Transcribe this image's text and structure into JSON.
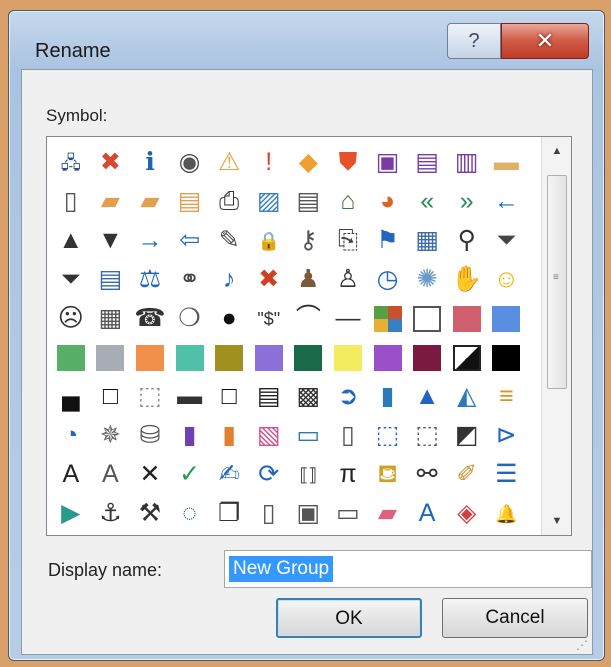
{
  "dialog": {
    "title": "Rename",
    "help_label": "?",
    "close_label": "✕"
  },
  "symbol_label": "Symbol:",
  "symbols": [
    {
      "name": "org-chart-icon",
      "glyph": "🖧",
      "color": "#2a4a8a"
    },
    {
      "name": "error-icon",
      "glyph": "✖",
      "color": "#d8472e"
    },
    {
      "name": "info-icon",
      "glyph": "ℹ",
      "color": "#2062b8"
    },
    {
      "name": "target-icon",
      "glyph": "◉",
      "color": "#555555"
    },
    {
      "name": "warning-icon",
      "glyph": "⚠",
      "color": "#e6a23c"
    },
    {
      "name": "exclamation-icon",
      "glyph": "!",
      "color": "#e04030"
    },
    {
      "name": "diamond-warning-icon",
      "glyph": "◆",
      "color": "#f0a030"
    },
    {
      "name": "shield-icon",
      "glyph": "⛊",
      "color": "#e8502a"
    },
    {
      "name": "save-icon",
      "glyph": "▣",
      "color": "#7a3aa8"
    },
    {
      "name": "translate-icon",
      "glyph": "▤",
      "color": "#7a3aa8"
    },
    {
      "name": "compare-icon",
      "glyph": "▥",
      "color": "#7a3aa8"
    },
    {
      "name": "folder-icon",
      "glyph": "▬",
      "color": "#e0b068"
    },
    {
      "name": "new-page-icon",
      "glyph": "▯",
      "color": "#555555"
    },
    {
      "name": "folder-up-icon",
      "glyph": "▰",
      "color": "#e0a050"
    },
    {
      "name": "folders-icon",
      "glyph": "▰",
      "color": "#e0a050"
    },
    {
      "name": "folder-list-icon",
      "glyph": "▤",
      "color": "#e0a050"
    },
    {
      "name": "print-icon",
      "glyph": "⎙",
      "color": "#333333"
    },
    {
      "name": "picture-icon",
      "glyph": "▨",
      "color": "#3a80c0"
    },
    {
      "name": "document-edit-icon",
      "glyph": "▤",
      "color": "#555555"
    },
    {
      "name": "home-icon",
      "glyph": "⌂",
      "color": "#3a7a3a"
    },
    {
      "name": "pie-chart-icon",
      "glyph": "◕",
      "color": "#e06020"
    },
    {
      "name": "back-double-icon",
      "glyph": "«",
      "color": "#2a8a5a"
    },
    {
      "name": "forward-double-icon",
      "glyph": "»",
      "color": "#2a8a5a"
    },
    {
      "name": "left-arrow-icon",
      "glyph": "←",
      "color": "#2066c0"
    },
    {
      "name": "triangle-up-icon",
      "glyph": "▲",
      "color": "#333333"
    },
    {
      "name": "triangle-down-icon",
      "glyph": "▼",
      "color": "#333333"
    },
    {
      "name": "right-arrow-icon",
      "glyph": "→",
      "color": "#2066c0"
    },
    {
      "name": "circle-left-arrow-icon",
      "glyph": "⇦",
      "color": "#2066c0"
    },
    {
      "name": "pin-icon",
      "glyph": "✎",
      "color": "#444444"
    },
    {
      "name": "lock-icon",
      "glyph": "🔒",
      "color": "#d89030"
    },
    {
      "name": "key-icon",
      "glyph": "⚷",
      "color": "#555555"
    },
    {
      "name": "script-icon",
      "glyph": "⎘",
      "color": "#444444"
    },
    {
      "name": "flag-icon",
      "glyph": "⚑",
      "color": "#2066c0"
    },
    {
      "name": "calendar-icon",
      "glyph": "▦",
      "color": "#3a6aa8"
    },
    {
      "name": "magnifier-icon",
      "glyph": "⚲",
      "color": "#333333"
    },
    {
      "name": "filter-icon",
      "glyph": "⏷",
      "color": "#444444"
    },
    {
      "name": "funnel-icon",
      "glyph": "⏷",
      "color": "#333333"
    },
    {
      "name": "reading-view-icon",
      "glyph": "▤",
      "color": "#3a6aa8"
    },
    {
      "name": "scales-icon",
      "glyph": "⚖",
      "color": "#2066c0"
    },
    {
      "name": "link-rings-icon",
      "glyph": "⚭",
      "color": "#444444"
    },
    {
      "name": "microphone-icon",
      "glyph": "♪",
      "color": "#2066c0"
    },
    {
      "name": "mute-icon",
      "glyph": "✖",
      "color": "#d04020"
    },
    {
      "name": "presenter-icon",
      "glyph": "♟",
      "color": "#7a5a3a"
    },
    {
      "name": "person-icon",
      "glyph": "♙",
      "color": "#333333"
    },
    {
      "name": "clock-icon",
      "glyph": "◷",
      "color": "#2066c0"
    },
    {
      "name": "sparkle-icon",
      "glyph": "✺",
      "color": "#6a9ac8"
    },
    {
      "name": "hand-icon",
      "glyph": "✋",
      "color": "#555555"
    },
    {
      "name": "smiley-icon",
      "glyph": "☺",
      "color": "#e8b800"
    },
    {
      "name": "sad-face-icon",
      "glyph": "☹",
      "color": "#333333"
    },
    {
      "name": "calculator-icon",
      "glyph": "▦",
      "color": "#555555"
    },
    {
      "name": "phone-icon",
      "glyph": "☎",
      "color": "#333333"
    },
    {
      "name": "piggy-bank-icon",
      "glyph": "❍",
      "color": "#555555"
    },
    {
      "name": "eight-ball-icon",
      "glyph": "●",
      "color": "#111111"
    },
    {
      "name": "dollar-string-icon",
      "glyph": "\"$\"",
      "color": "#333333"
    },
    {
      "name": "eye-arc-icon",
      "glyph": "⌒",
      "color": "#333333"
    },
    {
      "name": "dash-line-icon",
      "glyph": "—",
      "color": "#333333"
    },
    {
      "name": "swatch-multi",
      "swatch": "#c8502a"
    },
    {
      "name": "swatch-white",
      "swatch": "#ffffff",
      "border": "#555555"
    },
    {
      "name": "swatch-pink",
      "swatch": "#d06070"
    },
    {
      "name": "swatch-blue",
      "swatch": "#5a8ee0"
    },
    {
      "name": "swatch-green",
      "swatch": "#58b068"
    },
    {
      "name": "swatch-grey",
      "swatch": "#a8acb4"
    },
    {
      "name": "swatch-orange",
      "swatch": "#f0904a"
    },
    {
      "name": "swatch-teal",
      "swatch": "#50c0a8"
    },
    {
      "name": "swatch-olive",
      "swatch": "#a09020"
    },
    {
      "name": "swatch-lavender",
      "swatch": "#8a70d8"
    },
    {
      "name": "swatch-dark-green",
      "swatch": "#1a6a4a"
    },
    {
      "name": "swatch-yellow",
      "swatch": "#f4ec60"
    },
    {
      "name": "swatch-purple",
      "swatch": "#9a50c8"
    },
    {
      "name": "swatch-maroon",
      "swatch": "#7a1a40"
    },
    {
      "name": "swatch-diagonal",
      "swatch": "#222222",
      "border": "#222222"
    },
    {
      "name": "swatch-black",
      "swatch": "#000000"
    },
    {
      "name": "border-bottom-icon",
      "glyph": "▄",
      "color": "#111111"
    },
    {
      "name": "border-box-icon",
      "glyph": "□",
      "color": "#111111"
    },
    {
      "name": "border-dotted-icon",
      "glyph": "⬚",
      "color": "#888888"
    },
    {
      "name": "border-middle-icon",
      "glyph": "▬",
      "color": "#333333"
    },
    {
      "name": "border-outline-icon",
      "glyph": "□",
      "color": "#111111"
    },
    {
      "name": "border-stripe-icon",
      "glyph": "▤",
      "color": "#222222"
    },
    {
      "name": "checker-icon",
      "glyph": "▩",
      "color": "#333333"
    },
    {
      "name": "circle-arrow-icon",
      "glyph": "➲",
      "color": "#2066c0"
    },
    {
      "name": "bar-chart-icon",
      "glyph": "▮",
      "color": "#2a7ab8"
    },
    {
      "name": "cone-icon",
      "glyph": "▲",
      "color": "#2066c0"
    },
    {
      "name": "mountains-icon",
      "glyph": "◭",
      "color": "#2a7ab8"
    },
    {
      "name": "gantt-icon",
      "glyph": "≡",
      "color": "#e09020"
    },
    {
      "name": "pie-segment-icon",
      "glyph": "◔",
      "color": "#2066c0"
    },
    {
      "name": "radar-icon",
      "glyph": "✵",
      "color": "#666666"
    },
    {
      "name": "database-icon",
      "glyph": "⛁",
      "color": "#555555"
    },
    {
      "name": "book-purple-icon",
      "glyph": "▮",
      "color": "#7040b0"
    },
    {
      "name": "book-orange-icon",
      "glyph": "▮",
      "color": "#e08030"
    },
    {
      "name": "images-icon",
      "glyph": "▧",
      "color": "#d05090"
    },
    {
      "name": "area-chart-icon",
      "glyph": "▭",
      "color": "#2a7ab8"
    },
    {
      "name": "frame-icon",
      "glyph": "▯",
      "color": "#555555"
    },
    {
      "name": "contact-card-icon",
      "glyph": "⬚",
      "color": "#2066c0"
    },
    {
      "name": "form-icon",
      "glyph": "⬚",
      "color": "#555555"
    },
    {
      "name": "slash-chart-icon",
      "glyph": "◩",
      "color": "#333333"
    },
    {
      "name": "flow-icon",
      "glyph": "⊳",
      "color": "#2066c0"
    },
    {
      "name": "text-box-a-icon",
      "glyph": "A",
      "color": "#222222"
    },
    {
      "name": "shaded-a-icon",
      "glyph": "A",
      "color": "#555555"
    },
    {
      "name": "cross-icon",
      "glyph": "✕",
      "color": "#222222"
    },
    {
      "name": "check-icon",
      "glyph": "✓",
      "color": "#2a9a4a"
    },
    {
      "name": "chart-edit-icon",
      "glyph": "✍",
      "color": "#2066c0"
    },
    {
      "name": "refresh-icon",
      "glyph": "⟳",
      "color": "#2066c0"
    },
    {
      "name": "binary-icon",
      "glyph": "⟦⟧",
      "color": "#333333"
    },
    {
      "name": "pi-icon",
      "glyph": "π",
      "color": "#222222"
    },
    {
      "name": "paint-bucket-icon",
      "glyph": "⛾",
      "color": "#d0a020"
    },
    {
      "name": "binoculars-icon",
      "glyph": "⚯",
      "color": "#333333"
    },
    {
      "name": "brush-icon",
      "glyph": "✐",
      "color": "#d09030"
    },
    {
      "name": "bullet-list-icon",
      "glyph": "☰",
      "color": "#2066c0"
    },
    {
      "name": "play-icon",
      "glyph": "▶",
      "color": "#2a9a8a"
    },
    {
      "name": "anchor-icon",
      "glyph": "⚓",
      "color": "#333333"
    },
    {
      "name": "toolbox-icon",
      "glyph": "⚒",
      "color": "#333333"
    },
    {
      "name": "lasso-icon",
      "glyph": "◌",
      "color": "#2066c0"
    },
    {
      "name": "copy-icon",
      "glyph": "❐",
      "color": "#333333"
    },
    {
      "name": "door-icon",
      "glyph": "▯",
      "color": "#555555"
    },
    {
      "name": "frame-select-icon",
      "glyph": "▣",
      "color": "#555555"
    },
    {
      "name": "folder-outline-icon",
      "glyph": "▭",
      "color": "#555555"
    },
    {
      "name": "eraser-icon",
      "glyph": "▰",
      "color": "#e06080"
    },
    {
      "name": "text-a-blue-icon",
      "glyph": "A",
      "color": "#2066c0"
    },
    {
      "name": "office-logo-icon",
      "glyph": "◈",
      "color": "#d04040"
    },
    {
      "name": "bell-icon",
      "glyph": "🔔",
      "color": "#e8b030"
    },
    {
      "name": "envelope-open-icon",
      "glyph": "✉",
      "color": "#444444"
    }
  ],
  "display_name_label": "Display name:",
  "display_name_value": "New Group",
  "ok_label": "OK",
  "cancel_label": "Cancel"
}
